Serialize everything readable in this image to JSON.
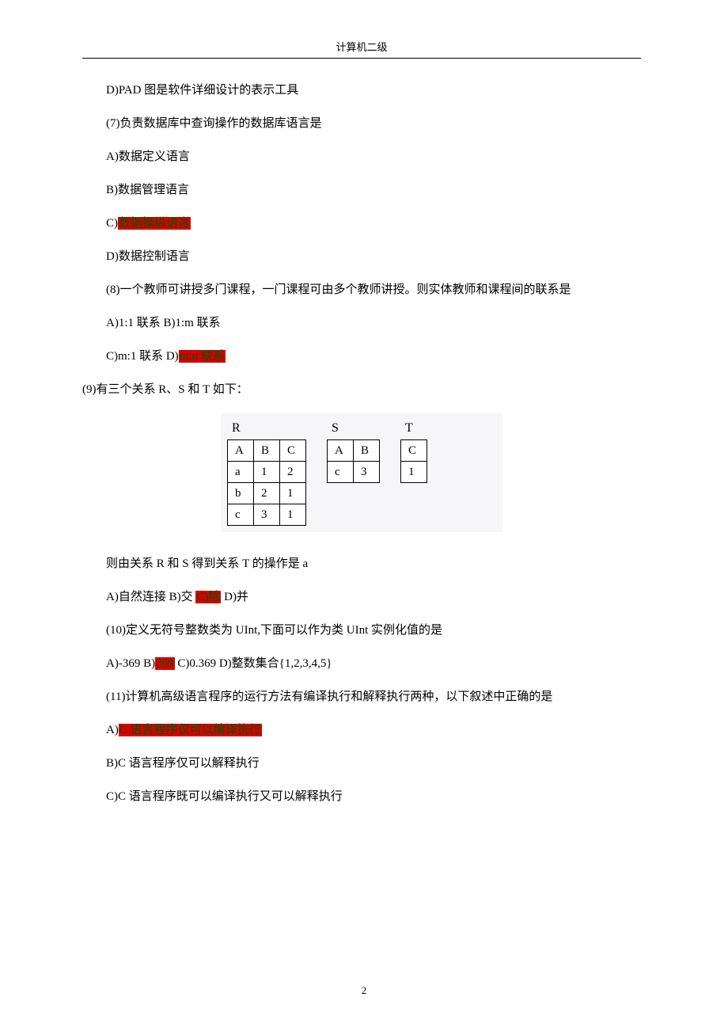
{
  "header": "计算机二级",
  "page_number": "2",
  "lines": {
    "d_pad": "D)PAD 图是软件详细设计的表示工具",
    "q7": "(7)负责数据库中查询操作的数据库语言是",
    "q7a": "A)数据定义语言",
    "q7b": "B)数据管理语言",
    "q7c_prefix": "C)",
    "q7c_hl": "数据操纵语言",
    "q7d": "D)数据控制语言",
    "q8": "(8)一个教师可讲授多门课程，一门课程可由多个教师讲授。则实体教师和课程间的联系是",
    "q8ab": "A)1:1 联系  B)1:m 联系",
    "q8c": "C)m:1 联系  D)",
    "q8d_hl": "m:n 联系",
    "q9": "(9)有三个关系 R、S 和 T 如下：",
    "q9_res": "则由关系 R 和 S 得到关系 T 的操作是 a",
    "q9_opts_a": "A)自然连接  B)交  ",
    "q9_opts_hl": "C)除",
    "q9_opts_d": "  D)并",
    "q10": "(10)定义无符号整数类为 UInt,下面可以作为类 UInt 实例化值的是",
    "q10a": "A)-369 B)",
    "q10b_hl": "369",
    "q10c": " C)0.369 D)整数集合{1,2,3,4,5}",
    "q11": "(11)计算机高级语言程序的运行方法有编译执行和解释执行两种，以下叙述中正确的是",
    "q11a_prefix": "A)",
    "q11a_hl": "C 语言程序仅可以编译执行",
    "q11b": "B)C 语言程序仅可以解释执行",
    "q11c": "C)C 语言程序既可以编译执行又可以解释执行"
  },
  "tables": {
    "R": {
      "label": "R",
      "headers": [
        "A",
        "B",
        "C"
      ],
      "rows": [
        [
          "a",
          "1",
          "2"
        ],
        [
          "b",
          "2",
          "1"
        ],
        [
          "c",
          "3",
          "1"
        ]
      ]
    },
    "S": {
      "label": "S",
      "headers": [
        "A",
        "B"
      ],
      "rows": [
        [
          "c",
          "3"
        ]
      ]
    },
    "T": {
      "label": "T",
      "headers": [
        "C"
      ],
      "rows": [
        [
          "1"
        ]
      ]
    }
  }
}
